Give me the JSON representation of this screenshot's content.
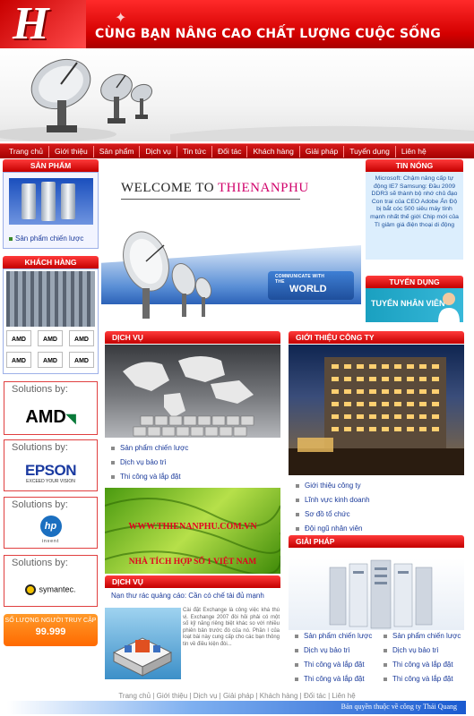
{
  "header": {
    "logo_letter": "H",
    "slogan": "CÙNG BẠN NÂNG CAO CHẤT LƯỢNG CUỘC SỐNG"
  },
  "nav": [
    "Trang chủ",
    "Giới thiệu",
    "Sản phẩm",
    "Dịch vụ",
    "Tin tức",
    "Đối tác",
    "Khách hàng",
    "Giải pháp",
    "Tuyển dụng",
    "Liên hệ"
  ],
  "left": {
    "products_title": "SẢN PHẨM",
    "products_link": "Sản phẩm chiến lược",
    "customers_title": "KHÁCH HÀNG",
    "customer_logos": [
      "AMD",
      "AMD",
      "AMD",
      "AMD",
      "AMD",
      "AMD"
    ],
    "solutions": [
      {
        "label": "Solutions by:",
        "brand": "AMD"
      },
      {
        "label": "Solutions by:",
        "brand": "EPSON",
        "tagline": "EXCEED YOUR VISION"
      },
      {
        "label": "Solutions by:",
        "brand": "hp",
        "tagline": "invent"
      },
      {
        "label": "Solutions by:",
        "brand": "symantec."
      }
    ],
    "counter_label": "SỐ LƯỢNG NGƯỜI TRUY CẬP",
    "counter_value": "99.999"
  },
  "center": {
    "welcome_prefix": "WELCOME TO ",
    "welcome_brand": "THIENANPHU",
    "welcome_cta_small": "COMMUNICATE WITH THE",
    "welcome_cta_big": "WORLD",
    "services_title": "DỊCH VỤ",
    "services_links": [
      "Sản phẩm chiến lược",
      "Dịch vụ bảo trì",
      "Thi công và lắp đặt"
    ],
    "banner_url": "WWW.THIENANPHU.COM.VN",
    "banner_tag": "NHÀ TÍCH HỢP SỐ 1 VIỆT NAM",
    "news_section_title": "DỊCH VỤ",
    "news_title": "Nạn thư rác quảng cáo: Cần có chế tài đủ mạnh",
    "news_body": "Cài đặt Exchange là công việc khá thú vị. Exchange 2007 đòi hỏi phải có một số kỹ năng riêng biệt khác so với nhiều phiên bản trước đó của nó. Phần I của loạt bài này cung cấp cho các bạn thông tin về điều kiện đòi..."
  },
  "right": {
    "hot_news_title": "TIN NÓNG",
    "hot_news_text": "Microsoft: Chậm nâng cấp tự động IE7 Samsung: Đầu 2009 DDR3 sẽ thành bộ nhớ chủ đạo Con trai của CEO Adobe Ấn Độ bị bắt cóc 500 siêu máy tính mạnh nhất thế giới Chip mới của TI giảm giá điện thoại di động",
    "recruit_title": "TUYỂN DỤNG",
    "recruit_banner": "TUYỂN NHÂN VIÊN",
    "intro_title": "GIỚI THIỆU CÔNG TY",
    "intro_links": [
      "Giới thiệu công ty",
      "Lĩnh vực kinh doanh",
      "Sơ đồ tổ chức",
      "Đội ngũ nhân viên"
    ],
    "solutions_title": "GIẢI PHÁP",
    "solutions_links_left": [
      "Sản phẩm chiến lược",
      "Dịch vụ bảo trì",
      "Thi công và lắp đặt",
      "Thi công và lắp đặt"
    ],
    "solutions_links_right": [
      "Sản phẩm chiến lược",
      "Dịch vụ bảo trì",
      "Thi công và lắp đặt",
      "Thi công và lắp đặt"
    ]
  },
  "footer": {
    "links": [
      "Trang chủ",
      "Giới thiệu",
      "Dịch vụ",
      "Giải pháp",
      "Khách hàng",
      "Đối tác",
      "Liên hệ"
    ],
    "separator": " | ",
    "copyright": "Bản quyền thuộc về công ty Thái Quang"
  }
}
